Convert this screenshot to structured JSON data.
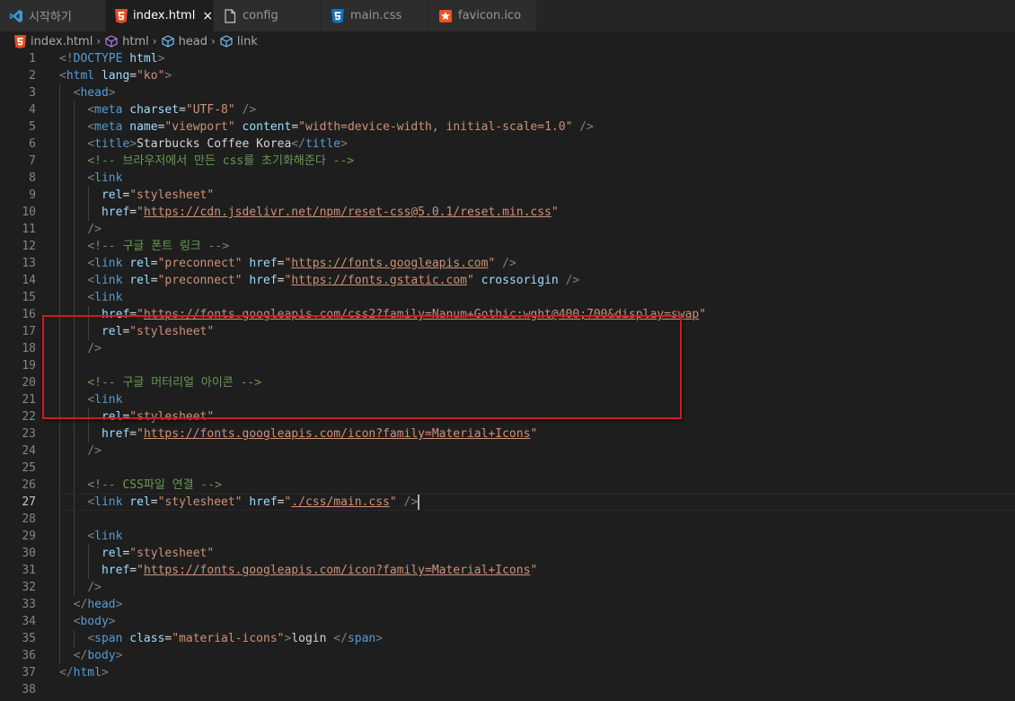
{
  "tabs": [
    {
      "label": "시작하기",
      "icon": "vscode-icon"
    },
    {
      "label": "index.html",
      "icon": "html5-icon",
      "active": true,
      "close": "×"
    },
    {
      "label": "config",
      "icon": "file-icon"
    },
    {
      "label": "main.css",
      "icon": "css3-icon"
    },
    {
      "label": "favicon.ico",
      "icon": "image-icon"
    }
  ],
  "breadcrumb": [
    "index.html",
    "html",
    "head",
    "link"
  ],
  "colors": {
    "tag": "#569cd6",
    "attr": "#9cdcfe",
    "string": "#ce9178",
    "comment": "#6a9955",
    "punctuation": "#808080",
    "highlight": "#d01c1c"
  },
  "editor": {
    "current_line": 27,
    "lines": [
      [
        [
          "p",
          "<!"
        ],
        [
          "t",
          "DOCTYPE"
        ],
        [
          "x",
          " "
        ],
        [
          "a",
          "html"
        ],
        [
          "p",
          ">"
        ]
      ],
      [
        [
          "p",
          "<"
        ],
        [
          "t",
          "html"
        ],
        [
          "x",
          " "
        ],
        [
          "a",
          "lang"
        ],
        [
          "x",
          "="
        ],
        [
          "s",
          "\"ko\""
        ],
        [
          "p",
          ">"
        ]
      ],
      [
        [
          "x",
          "  "
        ],
        [
          "p",
          "<"
        ],
        [
          "t",
          "head"
        ],
        [
          "p",
          ">"
        ]
      ],
      [
        [
          "x",
          "    "
        ],
        [
          "p",
          "<"
        ],
        [
          "t",
          "meta"
        ],
        [
          "x",
          " "
        ],
        [
          "a",
          "charset"
        ],
        [
          "x",
          "="
        ],
        [
          "s",
          "\"UTF-8\""
        ],
        [
          "x",
          " "
        ],
        [
          "p",
          "/>"
        ]
      ],
      [
        [
          "x",
          "    "
        ],
        [
          "p",
          "<"
        ],
        [
          "t",
          "meta"
        ],
        [
          "x",
          " "
        ],
        [
          "a",
          "name"
        ],
        [
          "x",
          "="
        ],
        [
          "s",
          "\"viewport\""
        ],
        [
          "x",
          " "
        ],
        [
          "a",
          "content"
        ],
        [
          "x",
          "="
        ],
        [
          "s",
          "\"width=device-width, initial-scale=1.0\""
        ],
        [
          "x",
          " "
        ],
        [
          "p",
          "/>"
        ]
      ],
      [
        [
          "x",
          "    "
        ],
        [
          "p",
          "<"
        ],
        [
          "t",
          "title"
        ],
        [
          "p",
          ">"
        ],
        [
          "x",
          "Starbucks Coffee Korea"
        ],
        [
          "p",
          "</"
        ],
        [
          "t",
          "title"
        ],
        [
          "p",
          ">"
        ]
      ],
      [
        [
          "x",
          "    "
        ],
        [
          "c",
          "<!-- 브라우저에서 만든 css를 초기화해준다 -->"
        ]
      ],
      [
        [
          "x",
          "    "
        ],
        [
          "p",
          "<"
        ],
        [
          "t",
          "link"
        ]
      ],
      [
        [
          "x",
          "      "
        ],
        [
          "a",
          "rel"
        ],
        [
          "x",
          "="
        ],
        [
          "s",
          "\"stylesheet\""
        ]
      ],
      [
        [
          "x",
          "      "
        ],
        [
          "a",
          "href"
        ],
        [
          "x",
          "="
        ],
        [
          "s",
          "\""
        ],
        [
          "u",
          "https://cdn.jsdelivr.net/npm/reset-css@5.0.1/reset.min.css"
        ],
        [
          "s",
          "\""
        ]
      ],
      [
        [
          "x",
          "    "
        ],
        [
          "p",
          "/>"
        ]
      ],
      [
        [
          "x",
          "    "
        ],
        [
          "c",
          "<!-- 구글 폰트 링크 -->"
        ]
      ],
      [
        [
          "x",
          "    "
        ],
        [
          "p",
          "<"
        ],
        [
          "t",
          "link"
        ],
        [
          "x",
          " "
        ],
        [
          "a",
          "rel"
        ],
        [
          "x",
          "="
        ],
        [
          "s",
          "\"preconnect\""
        ],
        [
          "x",
          " "
        ],
        [
          "a",
          "href"
        ],
        [
          "x",
          "="
        ],
        [
          "s",
          "\""
        ],
        [
          "u",
          "https://fonts.googleapis.com"
        ],
        [
          "s",
          "\""
        ],
        [
          "x",
          " "
        ],
        [
          "p",
          "/>"
        ]
      ],
      [
        [
          "x",
          "    "
        ],
        [
          "p",
          "<"
        ],
        [
          "t",
          "link"
        ],
        [
          "x",
          " "
        ],
        [
          "a",
          "rel"
        ],
        [
          "x",
          "="
        ],
        [
          "s",
          "\"preconnect\""
        ],
        [
          "x",
          " "
        ],
        [
          "a",
          "href"
        ],
        [
          "x",
          "="
        ],
        [
          "s",
          "\""
        ],
        [
          "u",
          "https://fonts.gstatic.com"
        ],
        [
          "s",
          "\""
        ],
        [
          "x",
          " "
        ],
        [
          "a",
          "crossorigin"
        ],
        [
          "x",
          " "
        ],
        [
          "p",
          "/>"
        ]
      ],
      [
        [
          "x",
          "    "
        ],
        [
          "p",
          "<"
        ],
        [
          "t",
          "link"
        ]
      ],
      [
        [
          "x",
          "      "
        ],
        [
          "a",
          "href"
        ],
        [
          "x",
          "="
        ],
        [
          "s",
          "\""
        ],
        [
          "u",
          "https://fonts.googleapis.com/css2?family=Nanum+Gothic:wght@400;700&display=swap"
        ],
        [
          "s",
          "\""
        ]
      ],
      [
        [
          "x",
          "      "
        ],
        [
          "a",
          "rel"
        ],
        [
          "x",
          "="
        ],
        [
          "s",
          "\"stylesheet\""
        ]
      ],
      [
        [
          "x",
          "    "
        ],
        [
          "p",
          "/>"
        ]
      ],
      [],
      [
        [
          "x",
          "    "
        ],
        [
          "c",
          "<!-- 구글 머터리얼 아이콘 -->"
        ]
      ],
      [
        [
          "x",
          "    "
        ],
        [
          "p",
          "<"
        ],
        [
          "t",
          "link"
        ]
      ],
      [
        [
          "x",
          "      "
        ],
        [
          "a",
          "rel"
        ],
        [
          "x",
          "="
        ],
        [
          "s",
          "\"stylesheet\""
        ]
      ],
      [
        [
          "x",
          "      "
        ],
        [
          "a",
          "href"
        ],
        [
          "x",
          "="
        ],
        [
          "s",
          "\""
        ],
        [
          "u",
          "https://fonts.googleapis.com/icon?family=Material+Icons"
        ],
        [
          "s",
          "\""
        ]
      ],
      [
        [
          "x",
          "    "
        ],
        [
          "p",
          "/>"
        ]
      ],
      [],
      [
        [
          "x",
          "    "
        ],
        [
          "c",
          "<!-- CSS파일 연결 -->"
        ]
      ],
      [
        [
          "x",
          "    "
        ],
        [
          "p",
          "<"
        ],
        [
          "t",
          "link"
        ],
        [
          "x",
          " "
        ],
        [
          "a",
          "rel"
        ],
        [
          "x",
          "="
        ],
        [
          "s",
          "\"stylesheet\""
        ],
        [
          "x",
          " "
        ],
        [
          "a",
          "href"
        ],
        [
          "x",
          "="
        ],
        [
          "s",
          "\""
        ],
        [
          "u",
          "./css/main.css"
        ],
        [
          "s",
          "\""
        ],
        [
          "x",
          " "
        ],
        [
          "p",
          "/>"
        ]
      ],
      [],
      [
        [
          "x",
          "    "
        ],
        [
          "p",
          "<"
        ],
        [
          "t",
          "link"
        ]
      ],
      [
        [
          "x",
          "      "
        ],
        [
          "a",
          "rel"
        ],
        [
          "x",
          "="
        ],
        [
          "s",
          "\"stylesheet\""
        ]
      ],
      [
        [
          "x",
          "      "
        ],
        [
          "a",
          "href"
        ],
        [
          "x",
          "="
        ],
        [
          "s",
          "\""
        ],
        [
          "u",
          "https://fonts.googleapis.com/icon?family=Material+Icons"
        ],
        [
          "s",
          "\""
        ]
      ],
      [
        [
          "x",
          "    "
        ],
        [
          "p",
          "/>"
        ]
      ],
      [
        [
          "x",
          "  "
        ],
        [
          "p",
          "</"
        ],
        [
          "t",
          "head"
        ],
        [
          "p",
          ">"
        ]
      ],
      [
        [
          "x",
          "  "
        ],
        [
          "p",
          "<"
        ],
        [
          "t",
          "body"
        ],
        [
          "p",
          ">"
        ]
      ],
      [
        [
          "x",
          "    "
        ],
        [
          "p",
          "<"
        ],
        [
          "t",
          "span"
        ],
        [
          "x",
          " "
        ],
        [
          "a",
          "class"
        ],
        [
          "x",
          "="
        ],
        [
          "s",
          "\"material-icons\""
        ],
        [
          "p",
          ">"
        ],
        [
          "x",
          "login "
        ],
        [
          "p",
          "</"
        ],
        [
          "t",
          "span"
        ],
        [
          "p",
          ">"
        ]
      ],
      [
        [
          "x",
          "  "
        ],
        [
          "p",
          "</"
        ],
        [
          "t",
          "body"
        ],
        [
          "p",
          ">"
        ]
      ],
      [
        [
          "p",
          "</"
        ],
        [
          "t",
          "html"
        ],
        [
          "p",
          ">"
        ]
      ],
      []
    ]
  }
}
